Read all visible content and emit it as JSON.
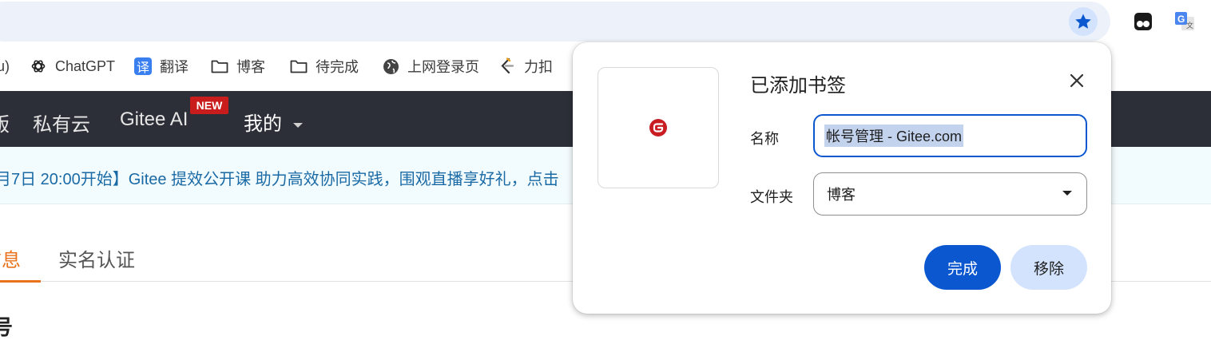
{
  "browser": {
    "star_icon": "star-filled-icon",
    "extensions": [
      {
        "name": "tampermonkey-extension-icon"
      },
      {
        "name": "google-translate-extension-icon"
      }
    ]
  },
  "bookmarks_bar": {
    "items": [
      {
        "label": "u)",
        "icon": "none"
      },
      {
        "label": "ChatGPT",
        "icon": "openai-icon"
      },
      {
        "label": "翻译",
        "icon": "translate-icon",
        "icon_glyph": "译"
      },
      {
        "label": "博客",
        "icon": "folder-icon"
      },
      {
        "label": "待完成",
        "icon": "folder-icon"
      },
      {
        "label": "上网登录页",
        "icon": "globe-icon"
      },
      {
        "label": "力扣",
        "icon": "leetcode-icon"
      }
    ]
  },
  "page": {
    "nav": {
      "items": [
        "版",
        "私有云",
        "Gitee AI",
        "我的"
      ],
      "new_badge": "NEW"
    },
    "banner": "月7日 20:00开始】Gitee 提效公开课 助力高效协同实践，围观直播享好礼，点击",
    "tabs": [
      {
        "label": "信息",
        "active": true
      },
      {
        "label": "实名认证",
        "active": false
      }
    ],
    "section_title": "号"
  },
  "bookmark_popup": {
    "title": "已添加书签",
    "name_label": "名称",
    "name_value": "帐号管理 - Gitee.com",
    "folder_label": "文件夹",
    "folder_value": "博客",
    "done_label": "完成",
    "remove_label": "移除",
    "favicon": "gitee-logo-icon",
    "colors": {
      "accent": "#0b57d0",
      "secondary": "#d3e3fd",
      "gitee_red": "#c71d23"
    }
  }
}
